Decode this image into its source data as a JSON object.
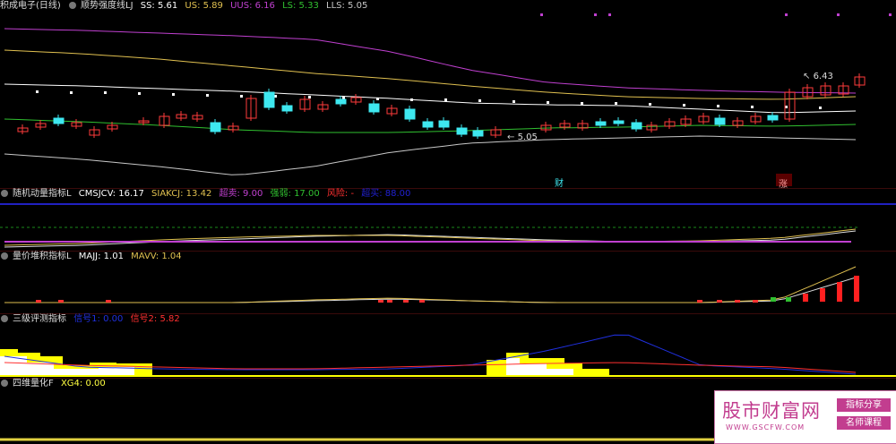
{
  "main": {
    "stock": "积成电子",
    "period": "(日线)",
    "indicator": "顺势强度线LJ",
    "ss": "SS: 5.61",
    "us": "US: 5.89",
    "uus": "UUS: 6.16",
    "ls": "LS: 5.33",
    "lls": "LLS: 5.05",
    "high_label": "6.43",
    "low_label": "5.05",
    "marker_cai": "财",
    "marker_zhang": "涨",
    "colors": {
      "up": "#ff3b3b",
      "down": "#3ee8f0",
      "ss": "#ffffff",
      "us": "#e0c050",
      "uus": "#c040d0",
      "ls": "#30c030",
      "lls": "#c8c8c8"
    }
  },
  "p1": {
    "title": "随机动量指标L",
    "cmsjcv": "CMSJCV: 16.17",
    "siakcj": "SIAKCJ: 13.42",
    "chaomai": "超卖: 9.00",
    "qiangruo": "强弱: 17.00",
    "fengxian": "风险: -",
    "extra": "超买: 88.00"
  },
  "p2": {
    "title": "量价堆积指标L",
    "majj": "MAJJ: 1.01",
    "mavv": "MAVV: 1.04"
  },
  "p3": {
    "title": "三级评测指标",
    "sig1": "信号1: 0.00",
    "sig2": "信号2: 5.82"
  },
  "p4": {
    "title": "四维量化F",
    "xg4": "XG4: 0.00"
  },
  "watermark": {
    "title": "股市财富网",
    "url": "WWW.GSCFW.COM",
    "badge1": "指标分享",
    "badge2": "名师课程"
  }
}
